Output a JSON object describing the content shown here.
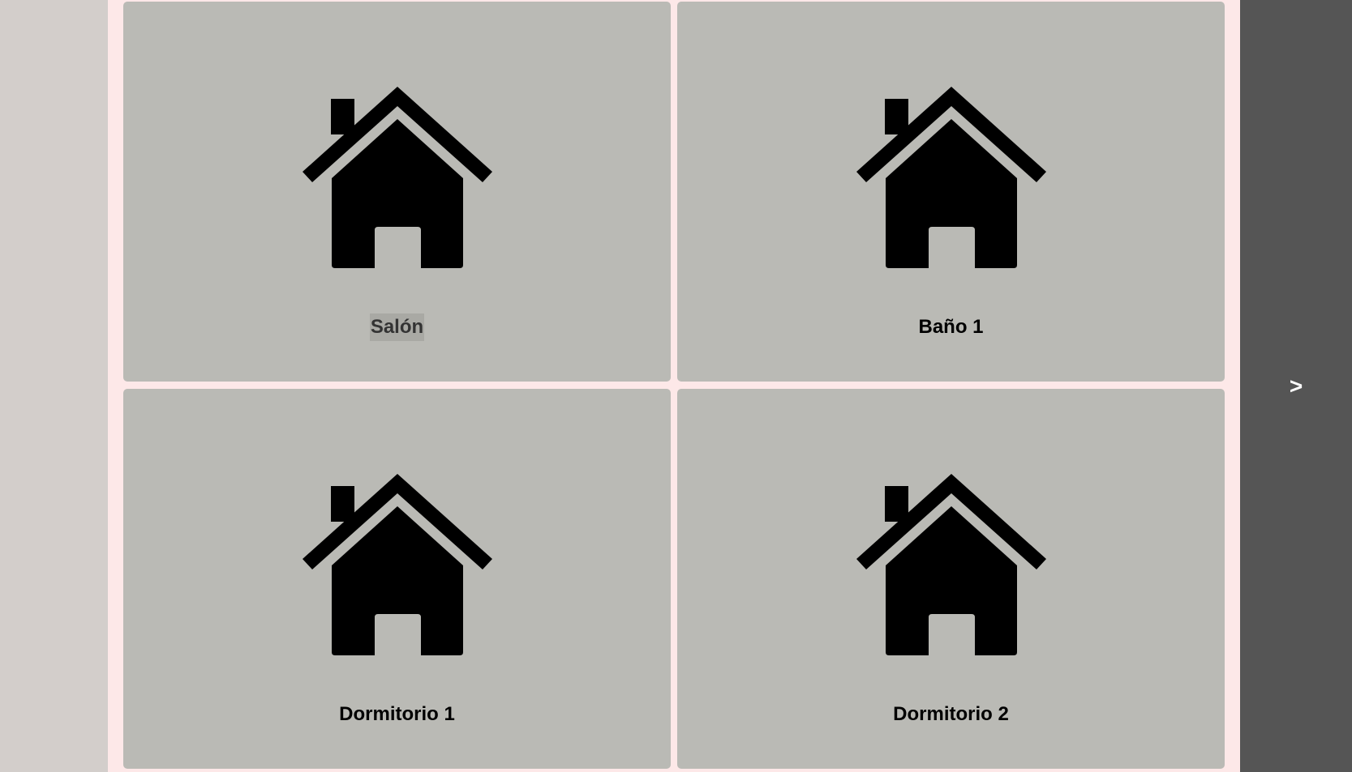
{
  "rooms": [
    {
      "label": "Salón",
      "icon": "house-icon",
      "selected": true
    },
    {
      "label": "Baño 1",
      "icon": "house-icon",
      "selected": false
    },
    {
      "label": "Dormitorio 1",
      "icon": "house-icon",
      "selected": false
    },
    {
      "label": "Dormitorio 2",
      "icon": "house-icon",
      "selected": false
    }
  ],
  "nav": {
    "next_label": ">"
  },
  "colors": {
    "card_background": "#babab5",
    "page_background": "#fde8e8",
    "side_panel": "#555555",
    "left_strip": "#d3cecb"
  }
}
